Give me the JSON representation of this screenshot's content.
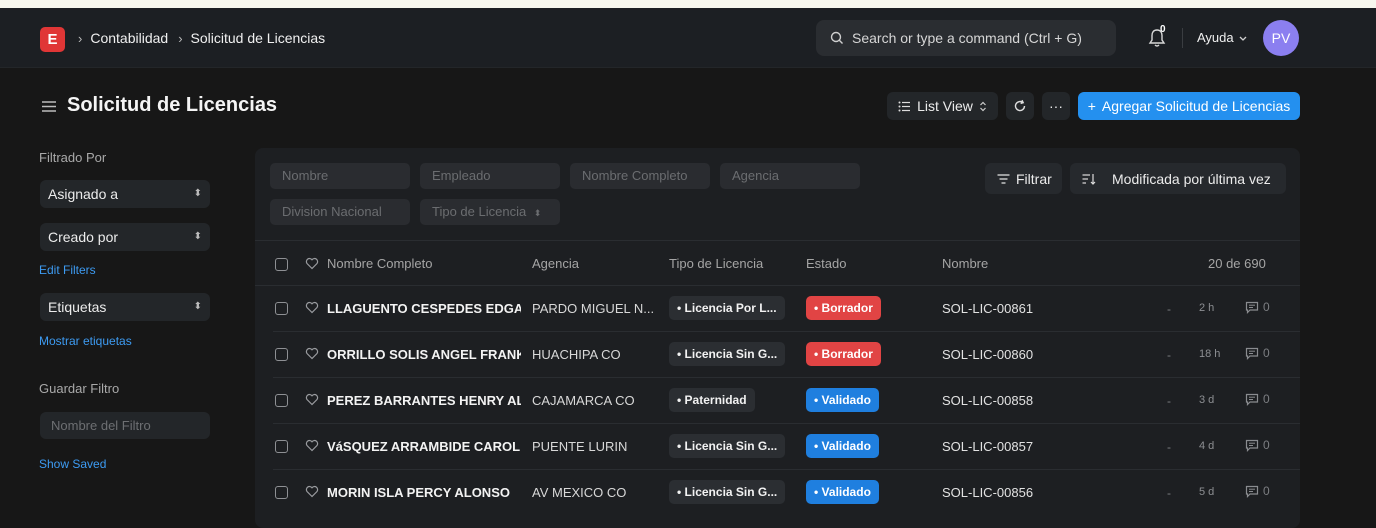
{
  "navbar": {
    "logo_letter": "E",
    "breadcrumbs": [
      "Contabilidad",
      "Solicitud de Licencias"
    ],
    "search_placeholder": "Search or type a command (Ctrl + G)",
    "notification_count": "0",
    "help_label": "Ayuda",
    "avatar_initials": "PV"
  },
  "page": {
    "title": "Solicitud de Licencias",
    "view_label": "List View",
    "more_label": "···",
    "primary_button": "Agregar Solicitud de Licencias"
  },
  "sidebar": {
    "filter_by_label": "Filtrado Por",
    "assigned_to": "Asignado a",
    "created_by": "Creado por",
    "edit_filters": "Edit Filters",
    "tags": "Etiquetas",
    "show_tags": "Mostrar etiquetas",
    "save_filter_label": "Guardar Filtro",
    "filter_name_placeholder": "Nombre del Filtro",
    "show_saved": "Show Saved"
  },
  "filters": {
    "nombre": "Nombre",
    "empleado": "Empleado",
    "nombre_completo": "Nombre Completo",
    "agencia": "Agencia",
    "division": "Division Nacional",
    "tipo": "Tipo de Licencia",
    "filter_button": "Filtrar",
    "sort_label": "Modificada por última vez"
  },
  "table": {
    "columns": {
      "nombre_completo": "Nombre Completo",
      "agencia": "Agencia",
      "tipo": "Tipo de Licencia",
      "estado": "Estado",
      "nombre": "Nombre"
    },
    "count": "20 de 690",
    "rows": [
      {
        "name": "LLAGUENTO CESPEDES EDGA",
        "agency": "PARDO MIGUEL N...",
        "type": "Licencia Por L...",
        "status": "Borrador",
        "status_color": "#e14444",
        "id": "SOL-LIC-00861",
        "dash": "-",
        "time": "2 h",
        "comments": "0"
      },
      {
        "name": "ORRILLO SOLIS ANGEL FRANK",
        "agency": "HUACHIPA CO",
        "type": "Licencia Sin G...",
        "status": "Borrador",
        "status_color": "#e14444",
        "id": "SOL-LIC-00860",
        "dash": "-",
        "time": "18 h",
        "comments": "0"
      },
      {
        "name": "PEREZ BARRANTES HENRY AL",
        "agency": "CAJAMARCA CO",
        "type": "Paternidad",
        "status": "Validado",
        "status_color": "#1f7fdf",
        "id": "SOL-LIC-00858",
        "dash": "-",
        "time": "3 d",
        "comments": "0"
      },
      {
        "name": "VáSQUEZ ARRAMBIDE CAROL",
        "agency": "PUENTE LURIN",
        "type": "Licencia Sin G...",
        "status": "Validado",
        "status_color": "#1f7fdf",
        "id": "SOL-LIC-00857",
        "dash": "-",
        "time": "4 d",
        "comments": "0"
      },
      {
        "name": "MORIN ISLA PERCY ALONSO",
        "agency": "AV MEXICO CO",
        "type": "Licencia Sin G...",
        "status": "Validado",
        "status_color": "#1f7fdf",
        "id": "SOL-LIC-00856",
        "dash": "-",
        "time": "5 d",
        "comments": "0"
      }
    ]
  }
}
